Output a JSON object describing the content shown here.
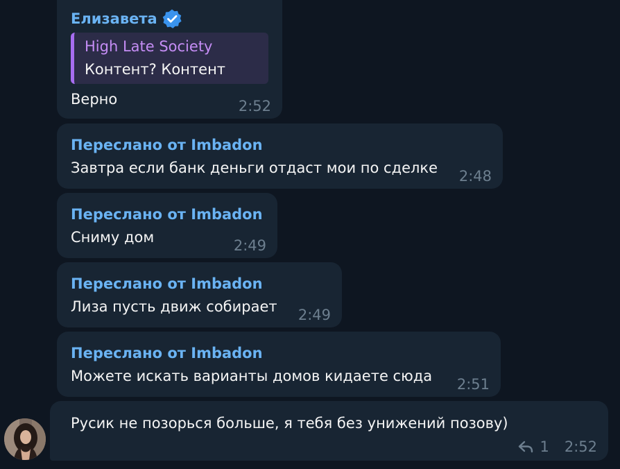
{
  "messages": [
    {
      "author": "Елизавета",
      "verified": true,
      "quote": {
        "title": "High Late Society",
        "text": "Контент? Контент"
      },
      "text": "Верно",
      "time": "2:52"
    },
    {
      "forwarded": "Переслано от Imbadon",
      "text": "Завтра если банк деньги отдаст мои по сделке",
      "time": "2:48"
    },
    {
      "forwarded": "Переслано от Imbadon",
      "text": "Сниму дом",
      "time": "2:49"
    },
    {
      "forwarded": "Переслано от Imbadon",
      "text": "Лиза пусть движ собирает",
      "time": "2:49"
    },
    {
      "forwarded": "Переслано от Imbadon",
      "text": "Можете искать варианты домов кидаете сюда",
      "time": "2:51"
    },
    {
      "text": "Русик не позорься больше, я тебя без унижений позову)",
      "reply_count": "1",
      "time": "2:52"
    }
  ],
  "colors": {
    "background": "#0e1621",
    "bubble": "#182533",
    "link_blue": "#6ab3f3",
    "quote_purple": "#a76df0",
    "time_gray": "#6d7f8f"
  },
  "icons": [
    "verified-badge-icon",
    "reply-icon",
    "avatar"
  ]
}
